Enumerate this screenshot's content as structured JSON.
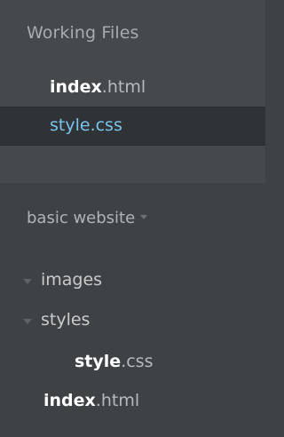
{
  "working_files": {
    "title": "Working Files",
    "items": [
      {
        "name": "index",
        "ext": ".html",
        "selected": false
      },
      {
        "name": "style",
        "ext": ".css",
        "selected": true
      }
    ]
  },
  "project": {
    "name": "basic website",
    "tree": [
      {
        "type": "folder",
        "label": "images",
        "expanded": false
      },
      {
        "type": "folder",
        "label": "styles",
        "expanded": true
      },
      {
        "type": "file",
        "name": "style",
        "ext": ".css"
      },
      {
        "type": "file",
        "name": "index",
        "ext": ".html"
      }
    ]
  },
  "colors": {
    "selected_text": "#79c4ef",
    "panel_bg": "#46494c",
    "sidebar_bg": "#3e4245"
  }
}
